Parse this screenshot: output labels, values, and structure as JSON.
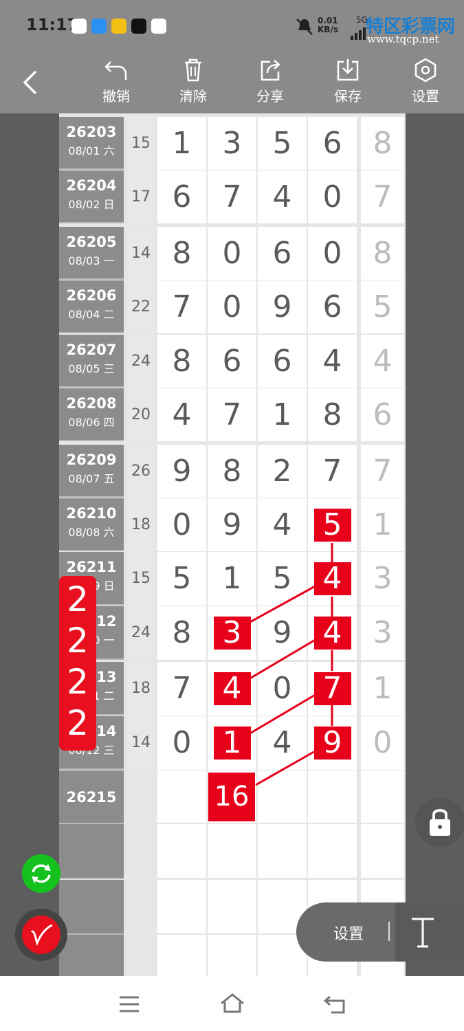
{
  "status": {
    "time": "11:17",
    "net_speed": "0.01\nKB/s",
    "net_type": "5G"
  },
  "watermark": {
    "brand": "特区彩票网",
    "url": "www.tqcp.net"
  },
  "toolbar": {
    "undo": "撤销",
    "clear": "清除",
    "share": "分享",
    "save": "保存",
    "settings": "设置"
  },
  "rows": [
    {
      "no": "26203",
      "date": "08/01 六",
      "sum": "15",
      "digits": [
        "1",
        "3",
        "5",
        "6"
      ],
      "extra": "8"
    },
    {
      "no": "26204",
      "date": "08/02 日",
      "sum": "17",
      "digits": [
        "6",
        "7",
        "4",
        "0"
      ],
      "extra": "7"
    },
    {
      "no": "26205",
      "date": "08/03 一",
      "sum": "14",
      "digits": [
        "8",
        "0",
        "6",
        "0"
      ],
      "extra": "8"
    },
    {
      "no": "26206",
      "date": "08/04 二",
      "sum": "22",
      "digits": [
        "7",
        "0",
        "9",
        "6"
      ],
      "extra": "5"
    },
    {
      "no": "26207",
      "date": "08/05 三",
      "sum": "24",
      "digits": [
        "8",
        "6",
        "6",
        "4"
      ],
      "extra": "4"
    },
    {
      "no": "26208",
      "date": "08/06 四",
      "sum": "20",
      "digits": [
        "4",
        "7",
        "1",
        "8"
      ],
      "extra": "6"
    },
    {
      "no": "26209",
      "date": "08/07 五",
      "sum": "26",
      "digits": [
        "9",
        "8",
        "2",
        "7"
      ],
      "extra": "7"
    },
    {
      "no": "26210",
      "date": "08/08 六",
      "sum": "18",
      "digits": [
        "0",
        "9",
        "4",
        "5"
      ],
      "extra": "1"
    },
    {
      "no": "26211",
      "date": "08/09 日",
      "sum": "15",
      "digits": [
        "5",
        "1",
        "5",
        "4"
      ],
      "extra": "3"
    },
    {
      "no": "26212",
      "date": "08/10 一",
      "sum": "24",
      "digits": [
        "8",
        "3",
        "9",
        "4"
      ],
      "extra": "3"
    },
    {
      "no": "26213",
      "date": "08/11 二",
      "sum": "18",
      "digits": [
        "7",
        "4",
        "0",
        "7"
      ],
      "extra": "1"
    },
    {
      "no": "26214",
      "date": "08/12 三",
      "sum": "14",
      "digits": [
        "0",
        "1",
        "4",
        "9"
      ],
      "extra": "0"
    }
  ],
  "next_issue": "26215",
  "prediction": "16",
  "badge": "2222",
  "bottom_settings": "设置",
  "colors": {
    "accent": "#e8001a",
    "sync": "#13c21c"
  }
}
